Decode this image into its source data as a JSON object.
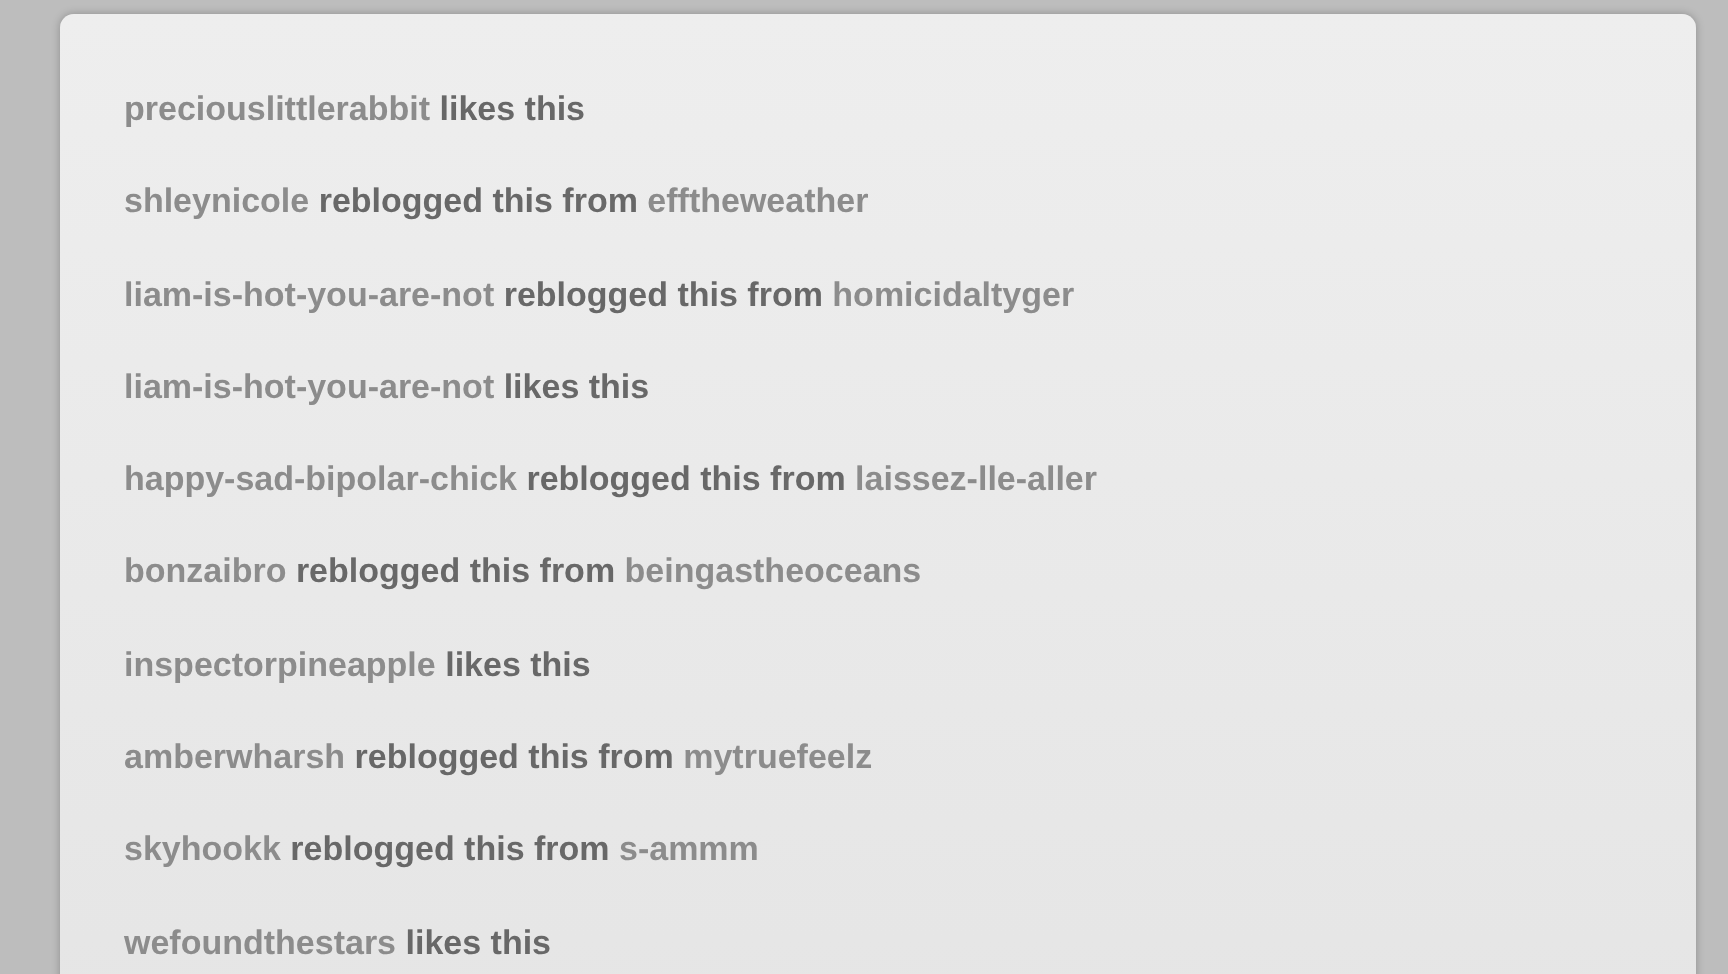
{
  "notes": [
    {
      "kind": "like",
      "user": "preciouslittlerabbit",
      "action": "likes this"
    },
    {
      "kind": "reblog",
      "user": "shleynicole",
      "action": "reblogged this from",
      "source": "efftheweather"
    },
    {
      "kind": "reblog",
      "user": "liam-is-hot-you-are-not",
      "action": "reblogged this from",
      "source": "homicidaltyger"
    },
    {
      "kind": "like",
      "user": "liam-is-hot-you-are-not",
      "action": "likes this"
    },
    {
      "kind": "reblog",
      "user": "happy-sad-bipolar-chick",
      "action": "reblogged this from",
      "source": "laissez-lle-aller"
    },
    {
      "kind": "reblog",
      "user": "bonzaibro",
      "action": "reblogged this from",
      "source": "beingastheoceans"
    },
    {
      "kind": "like",
      "user": "inspectorpineapple",
      "action": "likes this"
    },
    {
      "kind": "reblog",
      "user": "amberwharsh",
      "action": "reblogged this from",
      "source": "mytruefeelz"
    },
    {
      "kind": "reblog",
      "user": "skyhookk",
      "action": "reblogged this from",
      "source": "s-ammm"
    },
    {
      "kind": "like",
      "user": "wefoundthestars",
      "action": "likes this"
    }
  ]
}
